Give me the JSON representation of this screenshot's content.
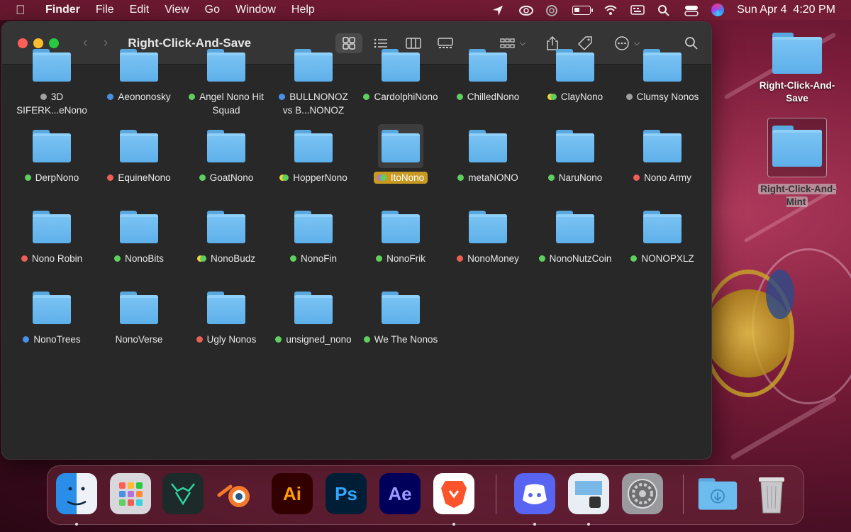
{
  "menubar": {
    "app_name": "Finder",
    "items": [
      "File",
      "Edit",
      "View",
      "Go",
      "Window",
      "Help"
    ],
    "clock": "Sun Apr 4  4:20 PM",
    "battery_level": 0.35
  },
  "window": {
    "title": "Right-Click-And-Save",
    "view_mode": "icons"
  },
  "tag_colors": {
    "gray": "#a0a0a0",
    "blue": "#4a90e8",
    "green": "#5fcf5f",
    "yellow": "#f2d23a",
    "red": "#ec5f55",
    "purple": "#b272e0"
  },
  "folders": [
    {
      "name": "3D SIFERK...eNono",
      "tags": [
        "gray"
      ]
    },
    {
      "name": "Aeononosky",
      "tags": [
        "blue"
      ]
    },
    {
      "name": "Angel Nono Hit Squad",
      "tags": [
        "green"
      ]
    },
    {
      "name": "BULLNONOZ vs B...NONOZ",
      "tags": [
        "blue"
      ]
    },
    {
      "name": "CardolphiNono",
      "tags": [
        "green"
      ]
    },
    {
      "name": "ChilledNono",
      "tags": [
        "green"
      ]
    },
    {
      "name": "ClayNono",
      "tags": [
        "yellow",
        "green"
      ]
    },
    {
      "name": "Clumsy Nonos",
      "tags": [
        "gray"
      ]
    },
    {
      "name": "DerpNono",
      "tags": [
        "green"
      ]
    },
    {
      "name": "EquineNono",
      "tags": [
        "red"
      ]
    },
    {
      "name": "GoatNono",
      "tags": [
        "green"
      ]
    },
    {
      "name": "HopperNono",
      "tags": [
        "yellow",
        "green"
      ]
    },
    {
      "name": "ItoNono",
      "tags": [
        "purple",
        "green"
      ],
      "selected": true
    },
    {
      "name": "metaNONO",
      "tags": [
        "green"
      ]
    },
    {
      "name": "NaruNono",
      "tags": [
        "green"
      ]
    },
    {
      "name": "Nono Army",
      "tags": [
        "red"
      ]
    },
    {
      "name": "Nono Robin",
      "tags": [
        "red"
      ]
    },
    {
      "name": "NonoBits",
      "tags": [
        "green"
      ]
    },
    {
      "name": "NonoBudz",
      "tags": [
        "yellow",
        "green"
      ]
    },
    {
      "name": "NonoFin",
      "tags": [
        "green"
      ]
    },
    {
      "name": "NonoFrik",
      "tags": [
        "green"
      ]
    },
    {
      "name": "NonoMoney",
      "tags": [
        "red"
      ]
    },
    {
      "name": "NonoNutzCoin",
      "tags": [
        "green"
      ]
    },
    {
      "name": "NONOPXLZ",
      "tags": [
        "green"
      ]
    },
    {
      "name": "NonoTrees",
      "tags": [
        "blue"
      ]
    },
    {
      "name": "NonoVerse",
      "tags": []
    },
    {
      "name": "Ugly Nonos",
      "tags": [
        "red"
      ]
    },
    {
      "name": "unsigned_nono",
      "tags": [
        "green"
      ]
    },
    {
      "name": "We The Nonos",
      "tags": [
        "green"
      ]
    }
  ],
  "desktop": [
    {
      "name": "Right-Click-And-Save",
      "selected": false
    },
    {
      "name": "Right-Click-And-Mint",
      "selected": true
    }
  ],
  "dock": {
    "apps": [
      "Finder",
      "Launchpad",
      "Bot",
      "Blender",
      "Ai",
      "Ps",
      "Ae",
      "Brave",
      "Discord",
      "Preview",
      "System Preferences",
      "Downloads",
      "Trash"
    ]
  }
}
